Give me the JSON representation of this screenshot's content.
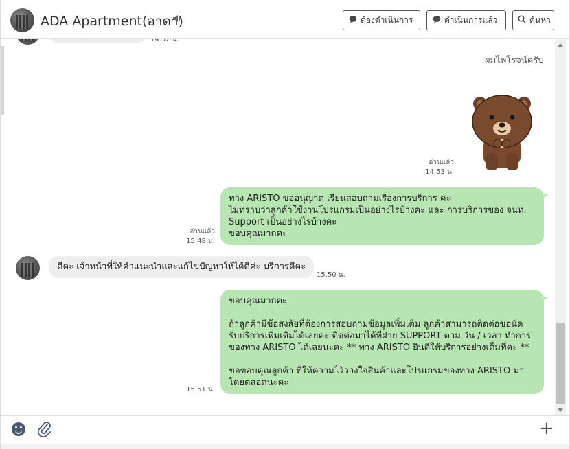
{
  "header": {
    "title": "ADA Apartment(อาดา)",
    "speaker_icon": "speaker-icon",
    "buttons": {
      "todo_label": "ต้องดำเนินการ",
      "done_label": "ดำเนินการแล้ว",
      "search_label": "ค้นหา"
    }
  },
  "chat": {
    "messages": [
      {
        "type": "in-partial",
        "time": "14.52 น."
      },
      {
        "type": "out-text-plain",
        "text": "ผมไพโรจน์ครับ"
      },
      {
        "type": "out-sticker",
        "sticker": "brown-bear-sticker",
        "status": "อ่านแล้ว",
        "time": "14.53 น."
      },
      {
        "type": "out",
        "text": "ทาง ARISTO ขออนุญาต เรียนสอบถามเรื่องการบริการ คะ\nไม่ทราบว่าลูกค้าใช้งานโปรแกรมเป็นอย่างไรบ้างคะ และ การบริการของ จนท.\nSupport เป็นอย่างไรบ้างคะ\nขอบคุณมากคะ",
        "status": "อ่านแล้ว",
        "time": "15.48 น."
      },
      {
        "type": "in",
        "text": "ดีคะ เจ้าหน้าที่ให้คำแนะนำและแก้ไขปัญหาให้ได้ดีค่ะ บริการดีคะ",
        "time": "15.50 น."
      },
      {
        "type": "out",
        "text": "ขอบคุณมากคะ\n\nถ้าลูกค้ามีข้อสงสัยที่ต้องการสอบถามข้อมูลเพิ่มเติม ลูกค้าสามารถติดต่อขอนัด\nรับบริการเพิ่มเติมได้เลยคะ ติดต่อมาได้ที่ฝ่าย SUPPORT ตาม วัน / เวลา ทำการ\nของทาง ARISTO ได้เลยนะคะ ** ทาง ARISTO ยินดีให้บริการอย่างเต็มที่คะ **\n\nขอขอบคุณลูกค้า ที่ให้ความไว้วางใจสินค้าและโปรแกรมของทาง ARISTO มา\nโดยตลอดนะคะ",
        "time": "15.51 น."
      }
    ]
  },
  "footer": {
    "emoji_icon": "smiley-icon",
    "attach_icon": "paperclip-icon",
    "add_icon": "plus-icon"
  },
  "colors": {
    "outgoing_bubble": "#b8e6b3",
    "incoming_bubble": "#eeeeee",
    "bear_fur": "#7a4a2e"
  }
}
